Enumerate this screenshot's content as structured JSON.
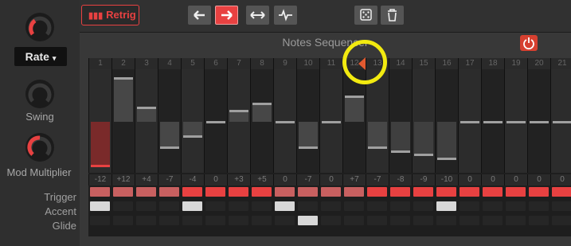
{
  "left": {
    "rate_label": "Rate",
    "swing_label": "Swing",
    "mod_label": "Mod Multiplier",
    "row_labels": [
      "Trigger",
      "Accent",
      "Glide"
    ]
  },
  "toolbar": {
    "retrig_label": "Retrig",
    "retrig_icon": "bars-icon",
    "direction_buttons": [
      "arrow-left-icon",
      "arrow-right-icon",
      "arrow-both-icon",
      "random-walk-icon"
    ],
    "active_direction": 1,
    "extra_buttons": [
      "dice-icon",
      "trash-icon"
    ]
  },
  "sequencer": {
    "title": "Notes Sequencer",
    "accent_color": "#e84141",
    "steps": [
      {
        "num": "1",
        "value": "-12",
        "level": -12,
        "trigger": "dim",
        "accent": true,
        "glide": false
      },
      {
        "num": "2",
        "value": "+12",
        "level": 12,
        "trigger": "dim",
        "accent": false,
        "glide": false
      },
      {
        "num": "3",
        "value": "+4",
        "level": 4,
        "trigger": "dim",
        "accent": false,
        "glide": false
      },
      {
        "num": "4",
        "value": "-7",
        "level": -7,
        "trigger": "dim",
        "accent": false,
        "glide": false
      },
      {
        "num": "5",
        "value": "-4",
        "level": -4,
        "trigger": "on",
        "accent": true,
        "glide": false
      },
      {
        "num": "6",
        "value": "0",
        "level": 0,
        "trigger": "on",
        "accent": false,
        "glide": false
      },
      {
        "num": "7",
        "value": "+3",
        "level": 3,
        "trigger": "on",
        "accent": false,
        "glide": false
      },
      {
        "num": "8",
        "value": "+5",
        "level": 5,
        "trigger": "on",
        "accent": false,
        "glide": false
      },
      {
        "num": "9",
        "value": "0",
        "level": 0,
        "trigger": "dim",
        "accent": true,
        "glide": false
      },
      {
        "num": "10",
        "value": "-7",
        "level": -7,
        "trigger": "dim",
        "accent": false,
        "glide": true
      },
      {
        "num": "11",
        "value": "0",
        "level": 0,
        "trigger": "dim",
        "accent": false,
        "glide": false
      },
      {
        "num": "12",
        "value": "+7",
        "level": 7,
        "trigger": "dim",
        "accent": false,
        "glide": false
      },
      {
        "num": "13",
        "value": "-7",
        "level": -7,
        "trigger": "on",
        "accent": false,
        "glide": false
      },
      {
        "num": "14",
        "value": "-8",
        "level": -8,
        "trigger": "on",
        "accent": false,
        "glide": false
      },
      {
        "num": "15",
        "value": "-9",
        "level": -9,
        "trigger": "on",
        "accent": false,
        "glide": false
      },
      {
        "num": "16",
        "value": "-10",
        "level": -10,
        "trigger": "on",
        "accent": true,
        "glide": false
      },
      {
        "num": "17",
        "value": "0",
        "level": 0,
        "trigger": "on",
        "accent": false,
        "glide": false
      },
      {
        "num": "18",
        "value": "0",
        "level": 0,
        "trigger": "on",
        "accent": false,
        "glide": false
      },
      {
        "num": "19",
        "value": "0",
        "level": 0,
        "trigger": "on",
        "accent": false,
        "glide": false
      },
      {
        "num": "20",
        "value": "0",
        "level": 0,
        "trigger": "on",
        "accent": false,
        "glide": false
      },
      {
        "num": "21",
        "value": "0",
        "level": 0,
        "trigger": "on",
        "accent": false,
        "glide": false
      }
    ]
  }
}
